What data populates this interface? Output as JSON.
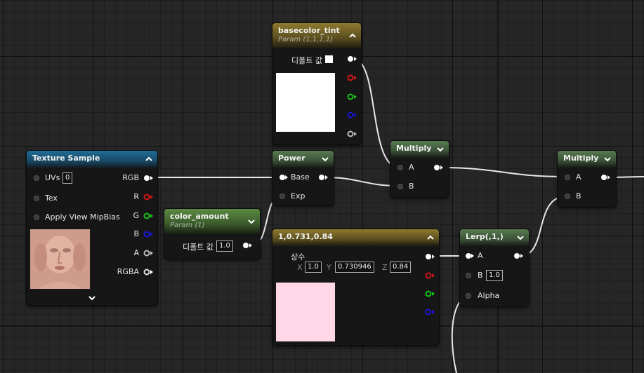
{
  "colors": {
    "texture_header": "#1f6d98",
    "param_header": "#8e7a2d",
    "math_header": "#5b8a42",
    "pin_red": "#d11717",
    "pin_green": "#17c317",
    "pin_blue": "#1717d1",
    "pin_gray": "#bcbcbc",
    "wire": "#e8e8e8",
    "constant_preview": "#ffd7e6",
    "tint_preview": "#ffffff"
  },
  "icons": {
    "collapse": "chevron-up-icon",
    "expand": "chevron-down-icon",
    "advanced": "chevron-down-icon"
  },
  "nodes": {
    "texture_sample": {
      "title": "Texture Sample",
      "inputs": {
        "uvs": "UVs",
        "uvs_value": "0",
        "tex": "Tex",
        "mipbias": "Apply View MipBias"
      },
      "outputs": {
        "rgb": "RGB",
        "r": "R",
        "g": "G",
        "b": "B",
        "a": "A",
        "rgba": "RGBA"
      }
    },
    "basecolor_tint": {
      "title": "basecolor_tint",
      "subtitle": "Param (1,1,1,1)",
      "default_label": "디폴트 값"
    },
    "color_amount": {
      "title": "color_amount",
      "subtitle": "Param (1)",
      "default_label": "디폴트 값",
      "default_value": "1.0"
    },
    "power": {
      "title": "Power",
      "base": "Base",
      "exp": "Exp"
    },
    "constant3": {
      "title": "1,0.731,0.84",
      "label": "상수",
      "x_label": "X",
      "x_value": "1.0",
      "y_label": "Y",
      "y_value": "0.730946",
      "z_label": "Z",
      "z_value": "0.84"
    },
    "multiply_1": {
      "title": "Multiply",
      "a": "A",
      "b": "B"
    },
    "multiply_2": {
      "title": "Multiply",
      "a": "A",
      "b": "B"
    },
    "lerp": {
      "title": "Lerp(,1,)",
      "a": "A",
      "b": "B",
      "b_value": "1.0",
      "alpha": "Alpha"
    }
  }
}
